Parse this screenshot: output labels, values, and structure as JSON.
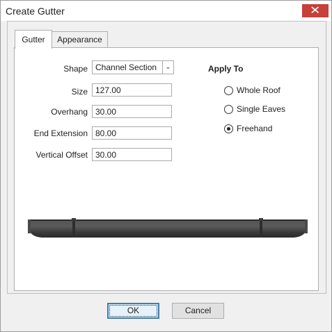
{
  "window": {
    "title": "Create Gutter",
    "close_glyph": "✕"
  },
  "tabs": [
    {
      "label": "Gutter",
      "active": true
    },
    {
      "label": "Appearance",
      "active": false
    }
  ],
  "form": {
    "shape": {
      "label": "Shape",
      "value": "Channel Section",
      "arrow": "⌄"
    },
    "size": {
      "label": "Size",
      "value": "127.00"
    },
    "overhang": {
      "label": "Overhang",
      "value": "30.00"
    },
    "end_extension": {
      "label": "End Extension",
      "value": "80.00"
    },
    "vertical_offset": {
      "label": "Vertical Offset",
      "value": "30.00"
    }
  },
  "apply_to": {
    "title": "Apply To",
    "options": [
      {
        "label": "Whole Roof",
        "checked": false
      },
      {
        "label": "Single Eaves",
        "checked": false
      },
      {
        "label": "Freehand",
        "checked": true
      }
    ]
  },
  "buttons": {
    "ok": "OK",
    "cancel": "Cancel"
  },
  "colors": {
    "close_red": "#c7403a",
    "gutter_dark": "#3f3f3f",
    "ok_border": "#3c7fb1"
  }
}
